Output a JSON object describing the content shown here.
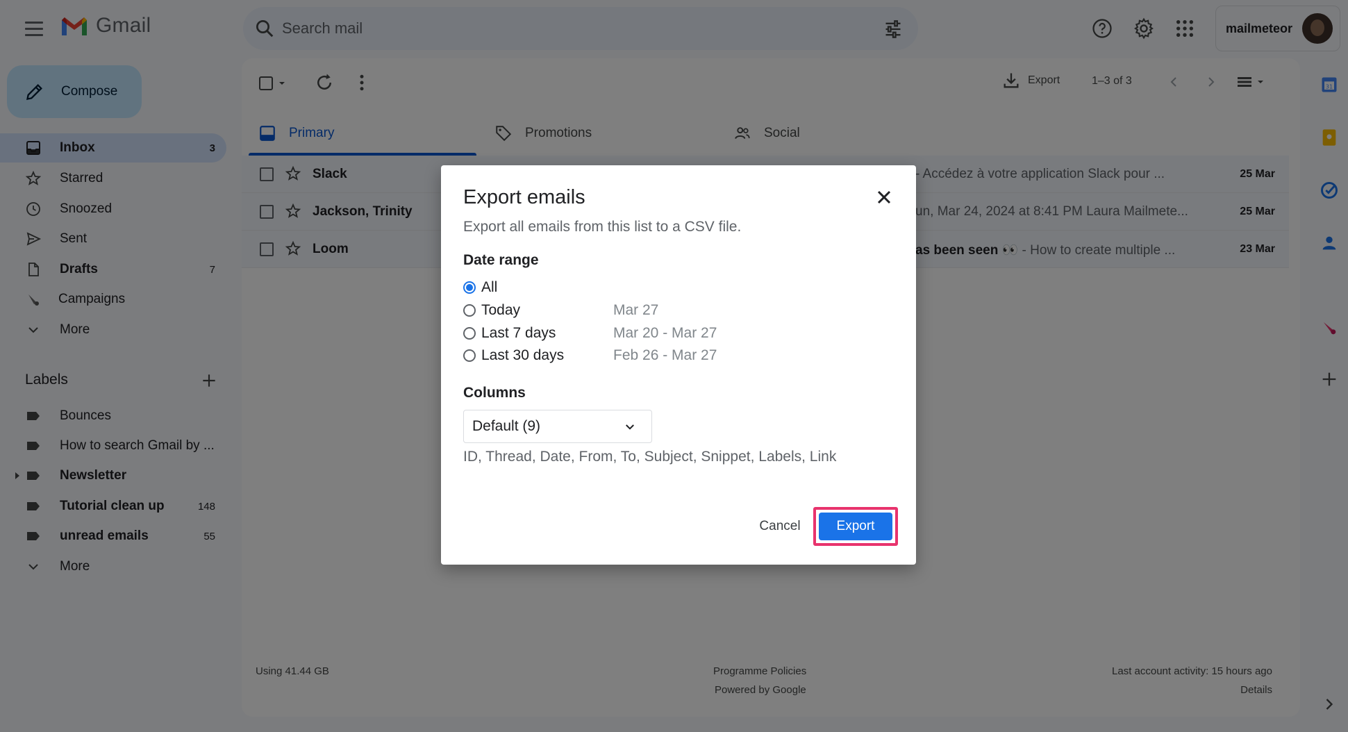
{
  "app": {
    "name": "Gmail"
  },
  "search": {
    "placeholder": "Search mail"
  },
  "account": {
    "name": "mailmeteor"
  },
  "compose": {
    "label": "Compose"
  },
  "nav": {
    "items": [
      {
        "label": "Inbox",
        "count": "3",
        "icon": "inbox-icon"
      },
      {
        "label": "Starred",
        "count": "",
        "icon": "star-icon"
      },
      {
        "label": "Snoozed",
        "count": "",
        "icon": "clock-icon"
      },
      {
        "label": "Sent",
        "count": "",
        "icon": "send-icon"
      },
      {
        "label": "Drafts",
        "count": "7",
        "icon": "draft-icon"
      },
      {
        "label": "Campaigns",
        "count": "",
        "icon": "campaigns-icon"
      },
      {
        "label": "More",
        "count": "",
        "icon": "chevron-down-icon"
      }
    ]
  },
  "labels": {
    "heading": "Labels",
    "items": [
      {
        "label": "Bounces",
        "count": ""
      },
      {
        "label": "How to search Gmail by ...",
        "count": ""
      },
      {
        "label": "Newsletter",
        "count": ""
      },
      {
        "label": "Tutorial clean up",
        "count": "148"
      },
      {
        "label": "unread emails",
        "count": "55"
      }
    ],
    "more": "More"
  },
  "toolbar": {
    "export_label": "Export",
    "pagination": "1–3 of 3"
  },
  "tabs": [
    {
      "label": "Primary"
    },
    {
      "label": "Promotions"
    },
    {
      "label": "Social"
    }
  ],
  "emails": [
    {
      "sender": "Slack",
      "snippet_bold": "",
      "snippet": "- Accédez à votre application Slack pour ...",
      "date": "25 Mar"
    },
    {
      "sender": "Jackson, Trinity",
      "snippet_bold": "",
      "snippet": "un, Mar 24, 2024 at 8:41 PM Laura Mailmete...",
      "date": "25 Mar"
    },
    {
      "sender": "Loom",
      "snippet_bold": "as been seen 👀",
      "snippet": " - How to create multiple ...",
      "date": "23 Mar"
    }
  ],
  "footer": {
    "storage": "Using 41.44 GB",
    "policies": "Programme Policies",
    "powered": "Powered by Google",
    "activity": "Last account activity: 15 hours ago",
    "details": "Details"
  },
  "dialog": {
    "title": "Export emails",
    "subtitle": "Export all emails from this list to a CSV file.",
    "date_range_heading": "Date range",
    "options": [
      {
        "label": "All",
        "hint": "",
        "checked": true
      },
      {
        "label": "Today",
        "hint": "Mar 27",
        "checked": false
      },
      {
        "label": "Last 7 days",
        "hint": "Mar 20 - Mar 27",
        "checked": false
      },
      {
        "label": "Last 30 days",
        "hint": "Feb 26 - Mar 27",
        "checked": false
      }
    ],
    "columns_heading": "Columns",
    "columns_select": "Default (9)",
    "columns_desc": "ID, Thread, Date, From, To, Subject, Snippet, Labels, Link",
    "cancel_label": "Cancel",
    "export_label": "Export"
  },
  "colors": {
    "accent": "#1a73e8",
    "highlight": "#e8336d",
    "compose_bg": "#c2e7ff"
  }
}
